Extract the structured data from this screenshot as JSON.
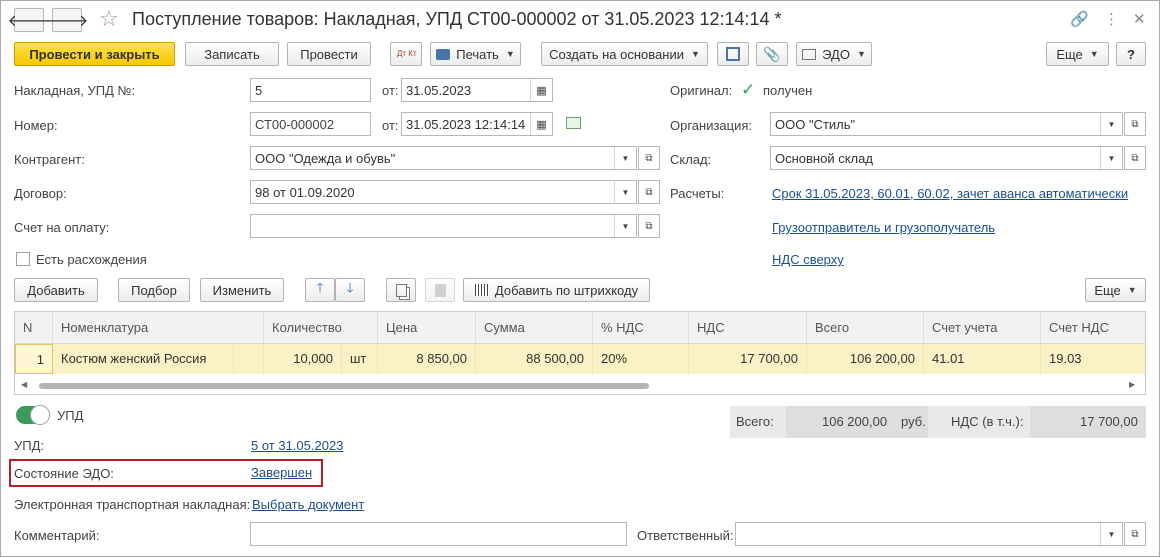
{
  "title": "Поступление товаров: Накладная, УПД СТ00-000002 от 31.05.2023 12:14:14 *",
  "nav": {
    "back_icon": "arrow-left-icon",
    "forward_icon": "arrow-right-icon",
    "star_icon": "star-icon",
    "back": "🡐",
    "forward": "🡒",
    "star": "☆"
  },
  "window_controls": {
    "link": "🔗",
    "menu": "⋮",
    "close": "✕"
  },
  "toolbar": {
    "post_close": "Провести и закрыть",
    "save": "Записать",
    "post": "Провести",
    "dtkt": "Дт Кт",
    "print": "Печать",
    "create_based": "Создать на основании",
    "edo": "ЭДО",
    "more": "Еще",
    "help": "?"
  },
  "form": {
    "invoice_label": "Накладная, УПД №:",
    "invoice_no": "5",
    "from1_label": "от:",
    "invoice_date": "31.05.2023",
    "original_label": "Оригинал:",
    "original_value": "получен",
    "number_label": "Номер:",
    "number_value": "СТ00-000002",
    "from2_label": "от:",
    "number_date": "31.05.2023 12:14:14",
    "org_label": "Организация:",
    "org_value": "ООО \"Стиль\"",
    "counterparty_label": "Контрагент:",
    "counterparty_value": "ООО \"Одежда и обувь\"",
    "warehouse_label": "Склад:",
    "warehouse_value": "Основной склад",
    "contract_label": "Договор:",
    "contract_value": "98 от 01.09.2020",
    "settlements_label": "Расчеты:",
    "settlements_link": "Срок 31.05.2023, 60.01, 60.02, зачет аванса автоматически",
    "invoice_pay_label": "Счет на оплату:",
    "invoice_pay_value": "",
    "shipper_link": "Грузоотправитель и грузополучатель",
    "discrepancy_label": "Есть расхождения",
    "vat_link": "НДС сверху"
  },
  "table_toolbar": {
    "add": "Добавить",
    "pick": "Подбор",
    "edit": "Изменить",
    "barcode": "Добавить по штрихкоду",
    "more": "Еще"
  },
  "table": {
    "headers": [
      "N",
      "Номенклатура",
      "Количество",
      "Цена",
      "Сумма",
      "% НДС",
      "НДС",
      "Всего",
      "Счет учета",
      "Счет НДС"
    ],
    "rows": [
      {
        "n": "1",
        "item": "Костюм женский Россия",
        "qty": "10,000",
        "unit": "шт",
        "price": "8 850,00",
        "sum": "88 500,00",
        "vat_rate": "20%",
        "vat": "17 700,00",
        "total": "106 200,00",
        "account": "41.01",
        "vat_account": "19.03"
      }
    ]
  },
  "totals": {
    "total_label": "Всего:",
    "total_value": "106 200,00",
    "currency": "руб.",
    "vat_label": "НДС (в т.ч.):",
    "vat_value": "17 700,00"
  },
  "footer": {
    "upd_toggle_label": "УПД",
    "upd_label": "УПД:",
    "upd_link": "5 от 31.05.2023",
    "edo_state_label": "Состояние ЭДО:",
    "edo_state_link": "Завершен",
    "etn_label": "Электронная транспортная накладная:",
    "etn_link": "Выбрать документ",
    "comment_label": "Комментарий:",
    "comment_value": "",
    "responsible_label": "Ответственный:",
    "responsible_value": ""
  },
  "colors": {
    "primary": "#f5c800",
    "link": "#1a4f95",
    "row_selected": "#fbf1c7",
    "highlight": "#b51f1f",
    "toggle_on": "#3c9a5a"
  }
}
